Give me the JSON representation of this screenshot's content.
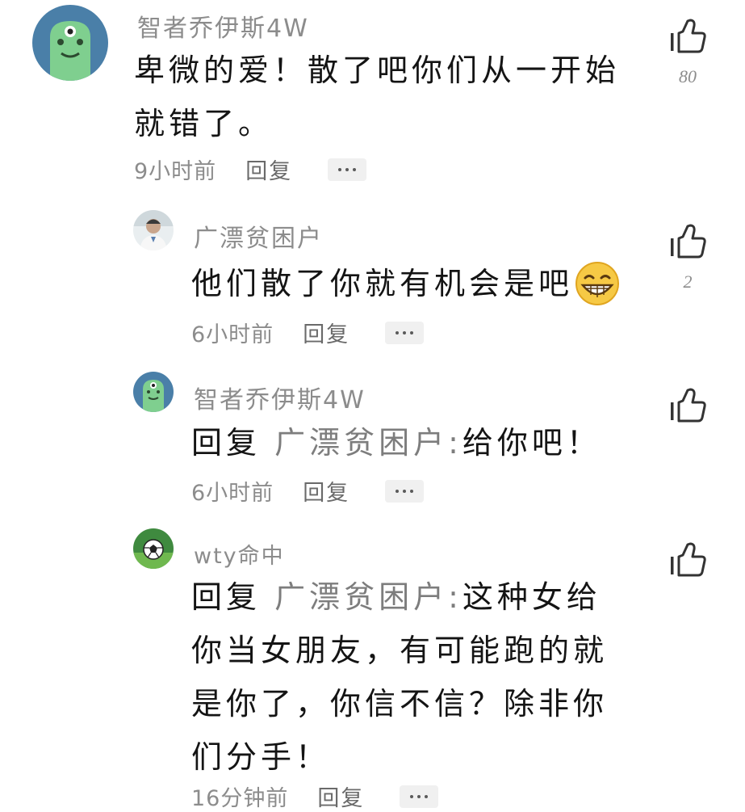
{
  "comments": [
    {
      "username": "智者乔伊斯4W",
      "text": "卑微的爱！散了吧你们从一开始就错了。",
      "time": "9小时前",
      "reply_label": "回复",
      "likes": "80"
    },
    {
      "username": "广漂贫困户",
      "text": "他们散了你就有机会是吧",
      "time": "6小时前",
      "reply_label": "回复",
      "likes": "2"
    },
    {
      "username": "智者乔伊斯4W",
      "reply_prefix": "回复",
      "reply_target": "广漂贫困户:",
      "text": "给你吧！",
      "time": "6小时前",
      "reply_label": "回复",
      "likes": ""
    },
    {
      "username": "wty命中",
      "reply_prefix": "回复",
      "reply_target": "广漂贫困户:",
      "text": "这种女给你当女朋友，有可能跑的就是你了，你信不信？除非你们分手！",
      "time": "16分钟前",
      "reply_label": "回复",
      "likes": ""
    }
  ],
  "icons": {
    "like": "thumbs-up-icon",
    "more": "more-dots-icon",
    "emoji": "grinning-emoji-icon"
  },
  "colors": {
    "username": "#8c8c8c",
    "body": "#141414",
    "reply_target": "#7d7d7d",
    "more_bg": "#f0f0f0",
    "avatar_green": "#7fcf8f",
    "avatar_bg": "#4a7fa8"
  }
}
